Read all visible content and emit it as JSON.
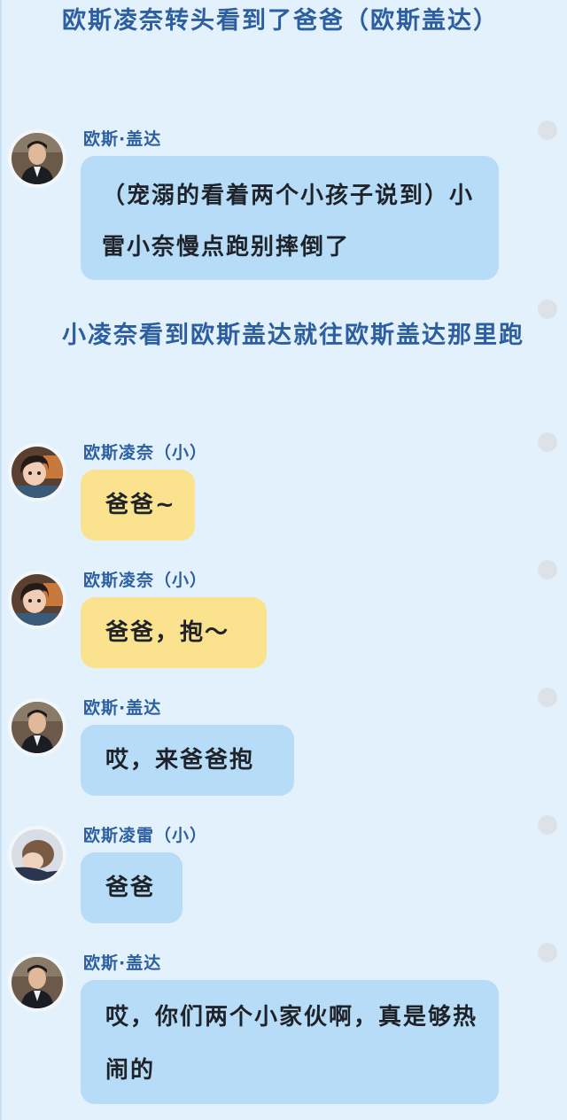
{
  "narrations": [
    {
      "text": "欧斯凌奈转头看到了爸爸（欧斯盖达）"
    },
    {
      "text": "小凌奈看到欧斯盖达就往欧斯盖达那里跑"
    }
  ],
  "messages": [
    {
      "sender": "欧斯·盖达",
      "text": "（宠溺的看着两个小孩子说到）小雷小奈慢点跑别摔倒了",
      "bubble_color": "#b6dcf7",
      "avatar": "man-avatar"
    },
    {
      "sender": "欧斯凌奈（小）",
      "text": "爸爸~",
      "bubble_color": "#fae28e",
      "avatar": "girl-avatar"
    },
    {
      "sender": "欧斯凌奈（小）",
      "text": "爸爸，抱～",
      "bubble_color": "#fae28e",
      "avatar": "girl-avatar"
    },
    {
      "sender": "欧斯·盖达",
      "text": "哎，来爸爸抱",
      "bubble_color": "#b6dcf7",
      "avatar": "man-avatar"
    },
    {
      "sender": "欧斯凌雷（小）",
      "text": "爸爸",
      "bubble_color": "#b6dcf7",
      "avatar": "boy-avatar"
    },
    {
      "sender": "欧斯·盖达",
      "text": "哎，你们两个小家伙啊，真是够热闹的",
      "bubble_color": "#b6dcf7",
      "avatar": "man-avatar"
    }
  ],
  "colors": {
    "background": "#e3f1fc",
    "name_text": "#2d5fa0",
    "blue_bubble": "#b6dcf7",
    "yellow_bubble": "#fae28e"
  }
}
